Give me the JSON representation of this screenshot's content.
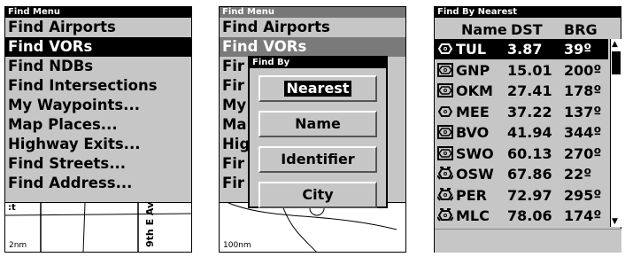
{
  "screen1": {
    "title": "Find Menu",
    "items": [
      "Find Airports",
      "Find VORs",
      "Find NDBs",
      "Find Intersections",
      "My Waypoints...",
      "Map Places...",
      "Highway Exits...",
      "Find Streets...",
      "Find Address..."
    ],
    "selected_index": 1,
    "map": {
      "scale": "2nm",
      "street": "9th E Av",
      "corner": ":t"
    }
  },
  "screen2": {
    "title": "Find Menu",
    "items": [
      "Find Airports",
      "Find VORs",
      "Fir",
      "Fir",
      "My",
      "Ma",
      "Hig",
      "Fir",
      "Fir"
    ],
    "dialog": {
      "title": "Find By",
      "buttons": [
        "Nearest",
        "Name",
        "Identifier",
        "City"
      ],
      "selected_index": 0
    },
    "map": {
      "scale": "100nm"
    }
  },
  "screen3": {
    "title": "Find By Nearest",
    "columns": [
      "Name",
      "DST",
      "BRG"
    ],
    "rows": [
      {
        "name": "TUL",
        "dst": "3.87",
        "brg": "39º",
        "icon": "vor-icon"
      },
      {
        "name": "GNP",
        "dst": "15.01",
        "brg": "200º",
        "icon": "vordme-icon"
      },
      {
        "name": "OKM",
        "dst": "27.41",
        "brg": "178º",
        "icon": "vordme-icon"
      },
      {
        "name": "MEE",
        "dst": "37.22",
        "brg": "137º",
        "icon": "vor-icon"
      },
      {
        "name": "BVO",
        "dst": "41.94",
        "brg": "344º",
        "icon": "vordme-icon"
      },
      {
        "name": "SWO",
        "dst": "60.13",
        "brg": "270º",
        "icon": "vordme-icon"
      },
      {
        "name": "OSW",
        "dst": "67.86",
        "brg": "22º",
        "icon": "vortac-icon"
      },
      {
        "name": "PER",
        "dst": "72.97",
        "brg": "295º",
        "icon": "vortac-icon"
      },
      {
        "name": "MLC",
        "dst": "78.06",
        "brg": "174º",
        "icon": "vortac-icon"
      }
    ],
    "selected_index": 0
  }
}
